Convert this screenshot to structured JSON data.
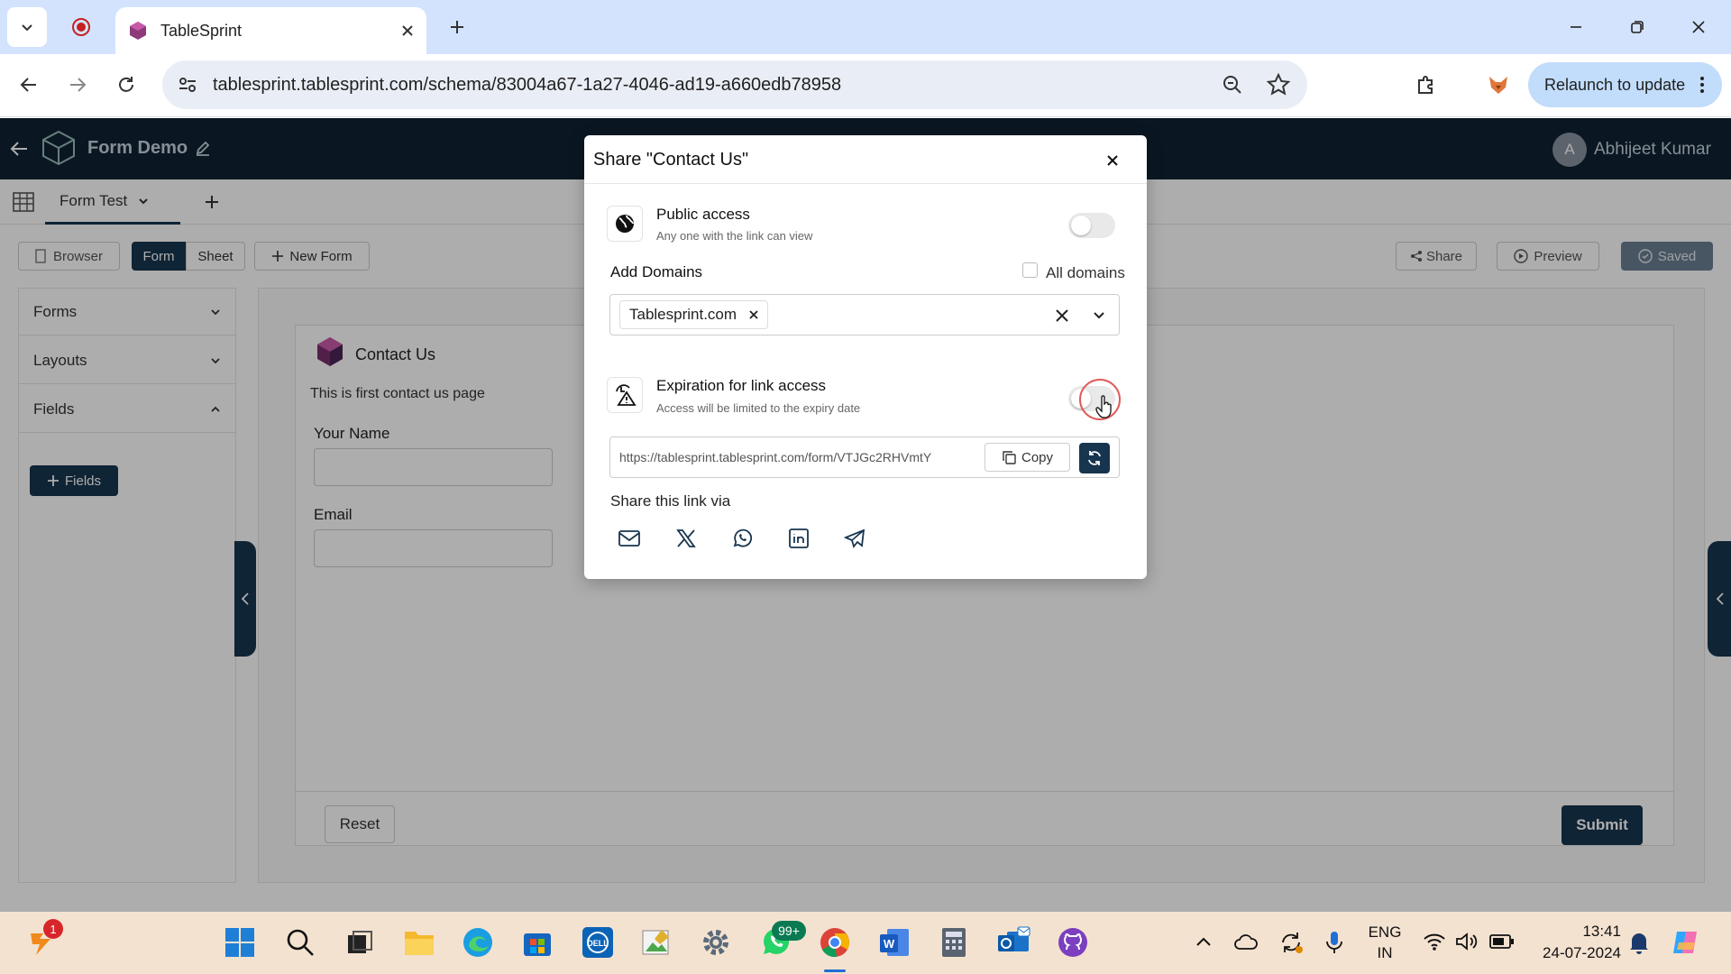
{
  "browser": {
    "tab_title": "TableSprint",
    "url": "tablesprint.tablesprint.com/schema/83004a67-1a27-4046-ad19-a660edb78958",
    "relaunch_label": "Relaunch to update"
  },
  "app": {
    "title": "Form Demo",
    "user_initial": "A",
    "user_name": "Abhijeet Kumar",
    "sheet_tab": "Form Test",
    "toolbar": {
      "browser": "Browser",
      "form": "Form",
      "sheet": "Sheet",
      "new_form": "New Form",
      "share": "Share",
      "preview": "Preview",
      "saved": "Saved"
    },
    "sidebar": {
      "items": [
        "Forms",
        "Layouts",
        "Fields"
      ],
      "fields_button": "Fields"
    },
    "form": {
      "title": "Contact Us",
      "description": "This is first contact us page",
      "fields": [
        "Your Name",
        "Email"
      ],
      "reset": "Reset",
      "submit": "Submit"
    }
  },
  "modal": {
    "title": "Share \"Contact Us\"",
    "public_access": {
      "title": "Public access",
      "subtitle": "Any one with the link can view",
      "enabled": false
    },
    "add_domains_label": "Add Domains",
    "all_domains_label": "All domains",
    "domains": [
      "Tablesprint.com"
    ],
    "expiration": {
      "title": "Expiration for link access",
      "subtitle": "Access will be limited to the expiry date",
      "enabled": false
    },
    "link": "https://tablesprint.tablesprint.com/form/VTJGc2RHVmtY",
    "copy_label": "Copy",
    "share_via_label": "Share this link via",
    "share_icons": [
      "mail-icon",
      "x-icon",
      "whatsapp-icon",
      "linkedin-icon",
      "telegram-icon"
    ]
  },
  "taskbar": {
    "notif_badge": "1",
    "whatsapp_badge": "99+",
    "lang": "ENG",
    "region": "IN",
    "time": "13:41",
    "date": "24-07-2024"
  },
  "colors": {
    "app_header": "#0f2233",
    "primary": "#17354f",
    "chrome_tabbar": "#d3e3fd"
  }
}
